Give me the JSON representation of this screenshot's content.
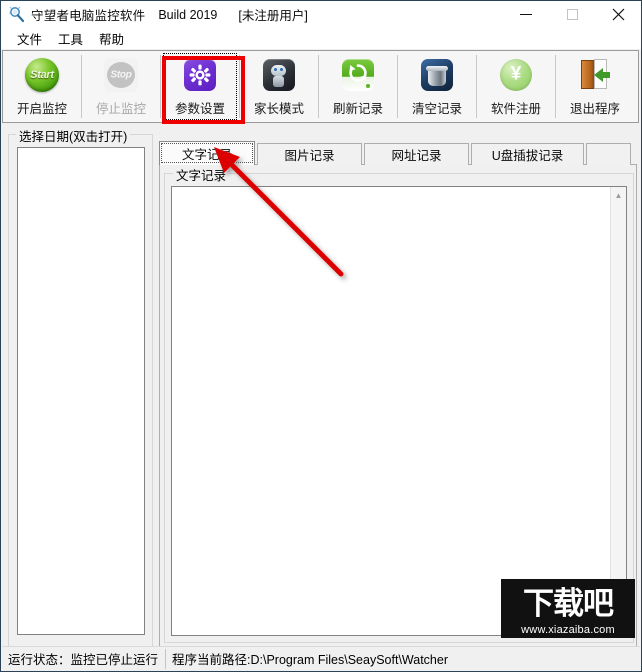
{
  "window": {
    "title": "守望者电脑监控软件",
    "build": "Build 2019",
    "registration": "[未注册用户]",
    "icon": "magnifier-icon",
    "controls": {
      "minimize": "minimize-icon",
      "maximize": "maximize-icon",
      "close": "close-icon"
    }
  },
  "menubar": {
    "items": [
      {
        "label": "文件"
      },
      {
        "label": "工具"
      },
      {
        "label": "帮助"
      }
    ]
  },
  "toolbar": {
    "buttons": [
      {
        "label": "开启监控",
        "icon": "start-icon",
        "state": "enabled"
      },
      {
        "label": "停止监控",
        "icon": "stop-icon",
        "state": "disabled"
      },
      {
        "label": "参数设置",
        "icon": "gear-icon",
        "state": "focused"
      },
      {
        "label": "家长模式",
        "icon": "robot-icon",
        "state": "enabled"
      },
      {
        "label": "刷新记录",
        "icon": "refresh-icon",
        "state": "enabled"
      },
      {
        "label": "清空记录",
        "icon": "trash-icon",
        "state": "enabled"
      },
      {
        "label": "软件注册",
        "icon": "yen-coin-icon",
        "state": "enabled"
      },
      {
        "label": "退出程序",
        "icon": "exit-door-icon",
        "state": "enabled"
      }
    ]
  },
  "left_panel": {
    "legend": "选择日期(双击打开)",
    "items": []
  },
  "tabs": {
    "items": [
      {
        "label": "文字记录",
        "active": true
      },
      {
        "label": "图片记录",
        "active": false
      },
      {
        "label": "网址记录",
        "active": false
      },
      {
        "label": "U盘插拔记录",
        "active": false
      }
    ]
  },
  "tab_panel": {
    "legend": "文字记录",
    "content": "",
    "scrollbar": {
      "up_arrow": "chevron-up-icon",
      "down_arrow": "chevron-down-icon"
    }
  },
  "statusbar": {
    "run_state": "运行状态：监控已停止运行",
    "path": "程序当前路径:D:\\Program Files\\SeaySoft\\Watcher"
  },
  "annotations": {
    "highlight_target": "参数设置",
    "arrow_target": "文字记录",
    "accent_color": "#ee0000"
  },
  "watermark": {
    "text": "下载吧",
    "url": "www.xiazaiba.com"
  }
}
